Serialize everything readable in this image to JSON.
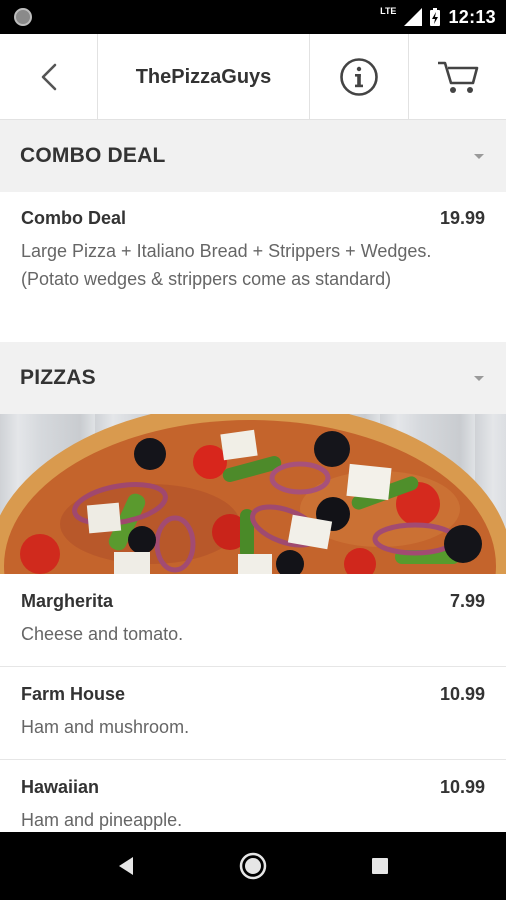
{
  "status_bar": {
    "network": "LTE",
    "time": "12:13"
  },
  "app_bar": {
    "title": "ThePizzaGuys",
    "icons": [
      "back-arrow-icon",
      "info-icon",
      "cart-icon"
    ]
  },
  "sections": {
    "combo": {
      "title": "COMBO DEAL",
      "items": [
        {
          "name": "Combo Deal",
          "price": "19.99",
          "description": "Large Pizza + Italiano Bread + Strippers + Wedges. (Potato wedges & strippers come as standard)"
        }
      ]
    },
    "pizzas": {
      "title": "PIZZAS",
      "items": [
        {
          "name": "Margherita",
          "price": "7.99",
          "description": "Cheese and tomato."
        },
        {
          "name": "Farm House",
          "price": "10.99",
          "description": "Ham and mushroom."
        },
        {
          "name": "Hawaiian",
          "price": "10.99",
          "description": "Ham and pineapple."
        }
      ]
    }
  },
  "nav_bar": {
    "icons": [
      "nav-back-icon",
      "nav-home-icon",
      "nav-recents-icon"
    ]
  },
  "colors": {
    "section_bg": "#f1f1f1",
    "text_primary": "#333333",
    "text_secondary": "#666666"
  }
}
